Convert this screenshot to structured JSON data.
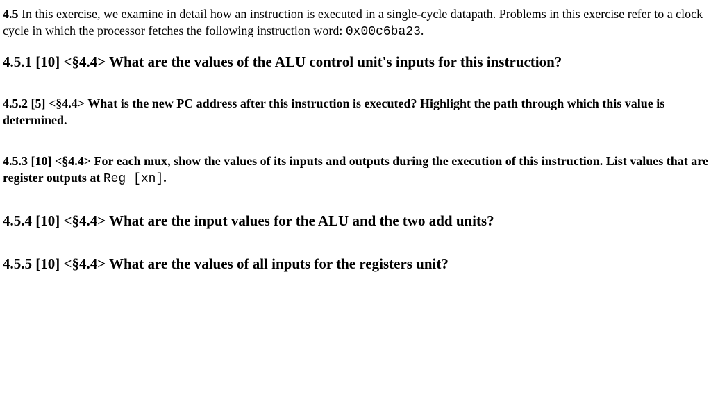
{
  "intro": {
    "lead": "4.5",
    "text1": " In this exercise, we examine in detail how an instruction is executed in a single-cycle datapath. Problems in this exercise refer to a clock cycle in which the processor fetches the following instruction word: ",
    "code": "0x00c6ba23",
    "text2": "."
  },
  "q1": {
    "num": "4.5.1",
    "meta": " [10] <§4.4> ",
    "text": "What are the values of the ALU control unit's inputs for this instruction?"
  },
  "q2": {
    "num": "4.5.2",
    "meta": " [5] <§4.4> ",
    "text": "What is the new PC address after this instruction is executed? Highlight the path through which this value is determined."
  },
  "q3": {
    "num": "4.5.3",
    "meta": " [10] <§4.4> ",
    "text1": "For each mux, show the values of its inputs and outputs during the execution of this instruction. List values that are register outputs at ",
    "reg": "Reg [xn]",
    "text2": "."
  },
  "q4": {
    "num": "4.5.4",
    "meta": " [10] <§4.4> ",
    "text": "What are the input values for the ALU and the two add units?"
  },
  "q5": {
    "num": "4.5.5",
    "meta": " [10] <§4.4> ",
    "text": "What are the values of all inputs for the registers unit?"
  }
}
